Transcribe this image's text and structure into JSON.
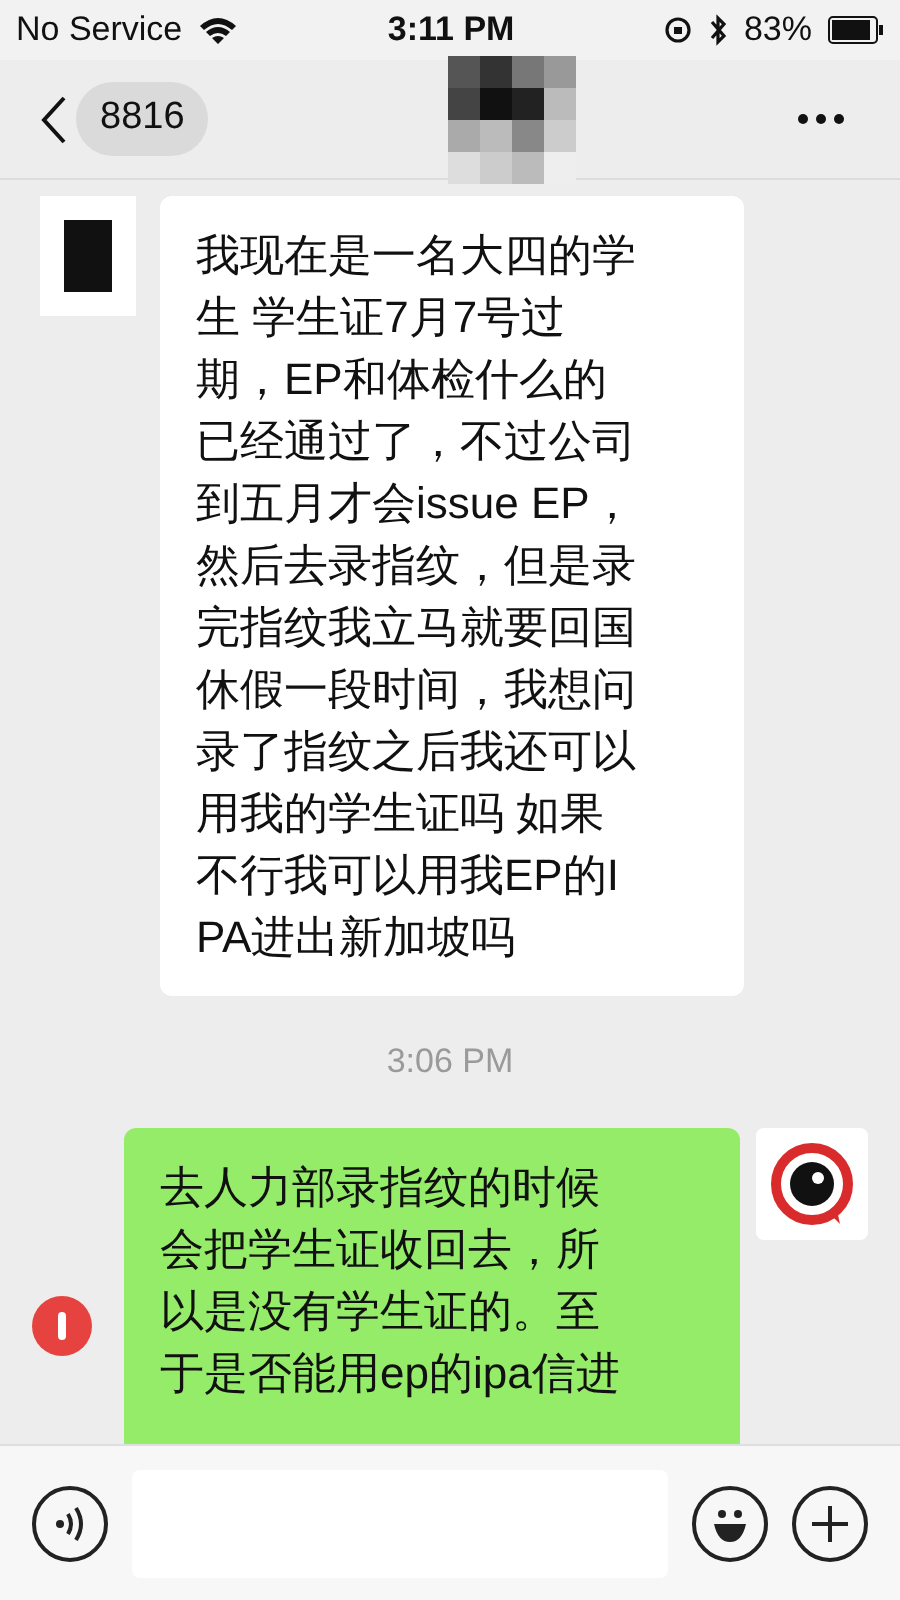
{
  "status_bar": {
    "carrier": "No Service",
    "time": "3:11 PM",
    "battery": "83%"
  },
  "nav": {
    "back_count": "8816"
  },
  "messages": [
    {
      "kind": "received",
      "text": "我现在是一名大四的学生 学生证7月7号过期，EP和体检什么的已经通过了，不过公司到五月才会issue EP，然后去录指纹，但是录完指纹我立马就要回国休假一段时间，我想问录了指纹之后我还可以用我的学生证吗 如果不行我可以用我EP的IPA进出新加坡吗"
    },
    {
      "kind": "time",
      "text": "3:06 PM"
    },
    {
      "kind": "sent",
      "text": "去人力部录指纹的时候会把学生证收回去，所以是没有学生证的。至于是否能用ep的ipa信进",
      "failed": true
    }
  ]
}
